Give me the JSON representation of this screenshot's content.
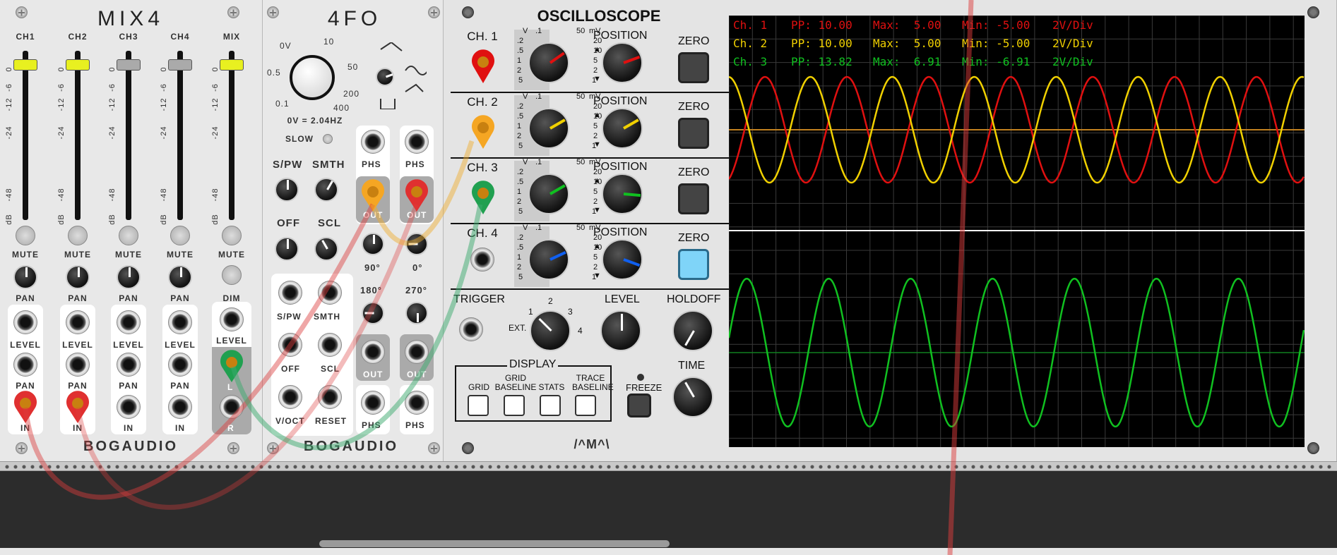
{
  "mix4": {
    "title": "MIX4",
    "brand": "BOGAUDIO",
    "channels": [
      {
        "label": "CH1",
        "cap_color": "#e8f020"
      },
      {
        "label": "CH2",
        "cap_color": "#e8f020"
      },
      {
        "label": "CH3",
        "cap_color": "#aaaaaa"
      },
      {
        "label": "CH4",
        "cap_color": "#aaaaaa"
      },
      {
        "label": "MIX",
        "cap_color": "#e8f020"
      }
    ],
    "db_scale": [
      "0",
      "-6",
      "-12",
      "-24",
      "-48",
      "dB"
    ],
    "mute_label": "MUTE",
    "pan_label": "PAN",
    "dim_label": "DIM",
    "level_label": "LEVEL",
    "in_label": "IN",
    "l_label": "L",
    "r_label": "R"
  },
  "fourfo": {
    "title": "4FO",
    "brand": "BOGAUDIO",
    "freq_scale": [
      "0V",
      "10",
      "0.5",
      "50",
      "0.1",
      "200",
      "400"
    ],
    "freq_readout": "0V = 2.04HZ",
    "slow_label": "SLOW",
    "spw_label": "S/PW",
    "smth_label": "SMTH",
    "off_label": "OFF",
    "scl_label": "SCL",
    "phs_label": "PHS",
    "out_label": "OUT",
    "phase_90": "90°",
    "phase_0": "0°",
    "phase_180": "180°",
    "phase_270": "270°",
    "voct_label": "V/OCT",
    "reset_label": "RESET"
  },
  "scope": {
    "title": "OSCILLOSCOPE",
    "brand": "/^M^\\",
    "channels": [
      {
        "label": "CH. 1",
        "color": "#e01010"
      },
      {
        "label": "CH. 2",
        "color": "#f0d000"
      },
      {
        "label": "CH. 3",
        "color": "#10c020"
      },
      {
        "label": "CH. 4",
        "color": "#1060f0"
      }
    ],
    "volt_scale": [
      "V",
      ".1",
      "50",
      "mV",
      ".2",
      "20",
      ".5",
      "10",
      "1",
      "5",
      "2",
      "2",
      "5",
      "1"
    ],
    "position_label": "POSITION",
    "zero_label": "ZERO",
    "trigger_label": "TRIGGER",
    "ext_label": "EXT.",
    "trig_scale": [
      "1",
      "2",
      "3",
      "4"
    ],
    "level_label": "LEVEL",
    "holdoff_label": "HOLDOFF",
    "display_label": "DISPLAY",
    "display_buttons": [
      "GRID",
      "GRID BASELINE",
      "STATS",
      "TRACE BASELINE"
    ],
    "freeze_label": "FREEZE",
    "time_label": "TIME",
    "stats": [
      {
        "ch": "Ch. 1",
        "pp": "PP: 10.00",
        "max": "Max:  5.00",
        "min": "Min: -5.00",
        "div": "2V/Div",
        "color": "#e01010"
      },
      {
        "ch": "Ch. 2",
        "pp": "PP: 10.00",
        "max": "Max:  5.00",
        "min": "Min: -5.00",
        "div": "2V/Div",
        "color": "#f0d000"
      },
      {
        "ch": "Ch. 3",
        "pp": "PP: 13.82",
        "max": "Max:  6.91",
        "min": "Min: -6.91",
        "div": "2V/Div",
        "color": "#10c020"
      }
    ]
  }
}
